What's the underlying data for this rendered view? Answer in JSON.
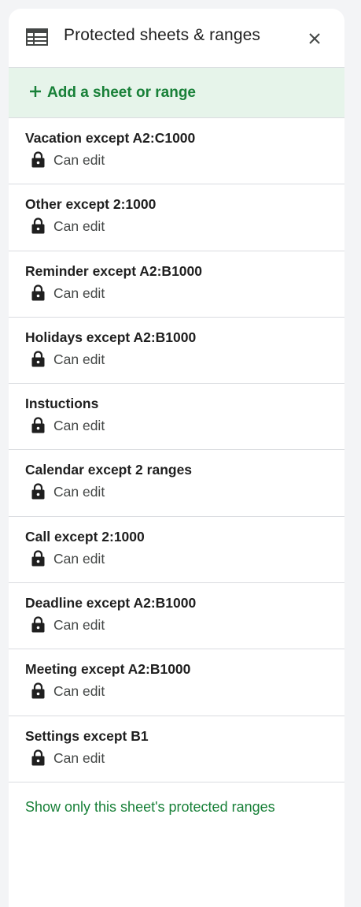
{
  "header": {
    "title": "Protected sheets & ranges",
    "icon": "table-icon",
    "close_icon": "close-icon"
  },
  "add": {
    "label": "Add a sheet or range",
    "icon": "plus-icon"
  },
  "items": [
    {
      "name": "Vacation except A2:C1000",
      "permission": "Can edit"
    },
    {
      "name": "Other except 2:1000",
      "permission": "Can edit"
    },
    {
      "name": "Reminder except A2:B1000",
      "permission": "Can edit"
    },
    {
      "name": "Holidays except A2:B1000",
      "permission": "Can edit"
    },
    {
      "name": "Instuctions",
      "permission": "Can edit"
    },
    {
      "name": "Calendar except 2 ranges",
      "permission": "Can edit"
    },
    {
      "name": "Call except 2:1000",
      "permission": "Can edit"
    },
    {
      "name": "Deadline except A2:B1000",
      "permission": "Can edit"
    },
    {
      "name": "Meeting except A2:B1000",
      "permission": "Can edit"
    },
    {
      "name": "Settings except B1",
      "permission": "Can edit"
    }
  ],
  "footer": {
    "show_only_label": "Show only this sheet's protected ranges"
  },
  "colors": {
    "accent_green": "#188038",
    "add_bg": "#e6f4ea",
    "divider": "#dadce0"
  }
}
